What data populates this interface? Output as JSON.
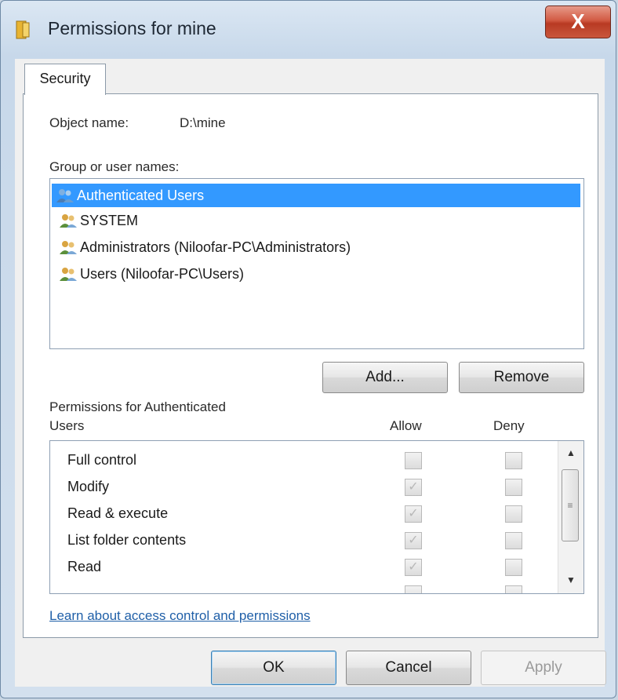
{
  "window": {
    "title": "Permissions for mine",
    "close_label": "X",
    "title_icon": "folder-icon"
  },
  "tabs": [
    {
      "label": "Security"
    }
  ],
  "object": {
    "label": "Object name:",
    "value": "D:\\mine"
  },
  "group_list": {
    "label": "Group or user names:",
    "items": [
      {
        "label": "Authenticated Users",
        "icon": "user-group-icon",
        "selected": true
      },
      {
        "label": "SYSTEM",
        "icon": "user-group-icon",
        "selected": false
      },
      {
        "label": "Administrators (Niloofar-PC\\Administrators)",
        "icon": "user-group-icon",
        "selected": false
      },
      {
        "label": "Users (Niloofar-PC\\Users)",
        "icon": "user-group-icon",
        "selected": false
      }
    ]
  },
  "buttons": {
    "add": "Add...",
    "remove": "Remove",
    "ok": "OK",
    "cancel": "Cancel",
    "apply": "Apply"
  },
  "permissions": {
    "label_line1": "Permissions for Authenticated",
    "label_line2": "Users",
    "allow_header": "Allow",
    "deny_header": "Deny",
    "rows": [
      {
        "name": "Full control",
        "allow": false,
        "deny": false
      },
      {
        "name": "Modify",
        "allow": true,
        "deny": false
      },
      {
        "name": "Read & execute",
        "allow": true,
        "deny": false
      },
      {
        "name": "List folder contents",
        "allow": true,
        "deny": false
      },
      {
        "name": "Read",
        "allow": true,
        "deny": false
      }
    ]
  },
  "link": {
    "text": "Learn about access control and permissions"
  },
  "colors": {
    "selection": "#3399ff",
    "link": "#1f5fa8",
    "close": "#c9563c"
  }
}
